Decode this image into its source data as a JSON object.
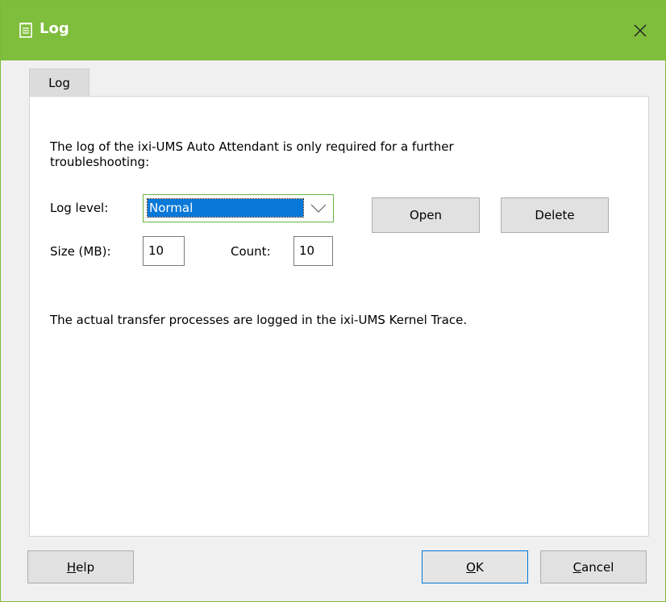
{
  "window": {
    "title": "Log",
    "title_icon": "notepad-icon",
    "close_icon": "close-icon"
  },
  "tabs": [
    {
      "label": "Log",
      "selected": true
    }
  ],
  "content": {
    "description": "The log of the ixi-UMS Auto Attendant is only required for a further troubleshooting:",
    "log_level": {
      "label": "Log level:",
      "value": "Normal"
    },
    "size": {
      "label": "Size (MB):",
      "value": "10"
    },
    "count": {
      "label": "Count:",
      "value": "10"
    },
    "open_label": "Open",
    "delete_label": "Delete",
    "note": "The actual transfer processes are logged in the ixi-UMS Kernel Trace."
  },
  "footer": {
    "help": {
      "mnemonic": "H",
      "rest": "elp"
    },
    "ok": {
      "mnemonic": "O",
      "rest": "K"
    },
    "cancel": {
      "mnemonic": "C",
      "rest": "ancel"
    }
  },
  "colors": {
    "titlebar": "#7fbd3c",
    "focus_border": "#6cb33f",
    "selection": "#0a78d7"
  }
}
